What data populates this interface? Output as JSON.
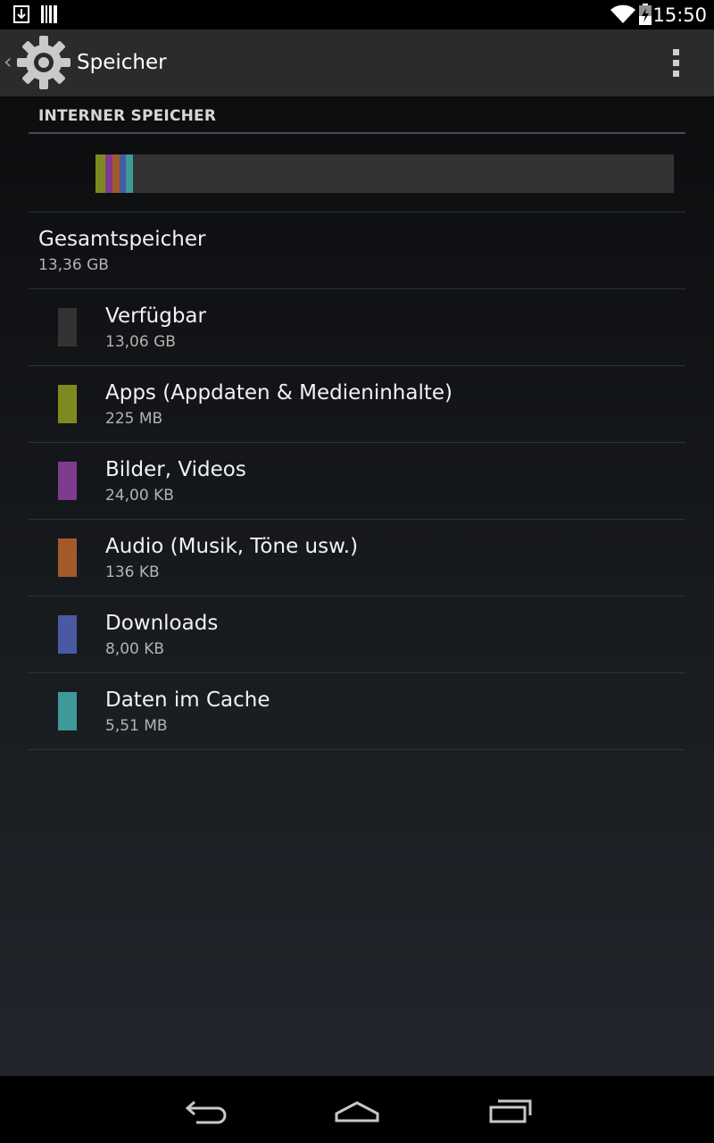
{
  "status_bar": {
    "time": "15:50",
    "icons": [
      "download-icon",
      "barcode-icon",
      "wifi-icon",
      "battery-charging-icon"
    ]
  },
  "action_bar": {
    "title": "Speicher",
    "icon": "settings-gear-icon",
    "overflow_icon": "overflow-menu-icon"
  },
  "storage": {
    "section_header": "INTERNER SPEICHER",
    "total": {
      "label": "Gesamtspeicher",
      "value": "13,36 GB"
    },
    "categories": [
      {
        "label": "Verfügbar",
        "value": "13,06 GB",
        "color": "#333333"
      },
      {
        "label": "Apps (Appdaten & Medieninhalte)",
        "value": "225 MB",
        "color": "#7f8a1e"
      },
      {
        "label": "Bilder, Videos",
        "value": "24,00 KB",
        "color": "#7f3b8e"
      },
      {
        "label": "Audio (Musik, Töne usw.)",
        "value": "136 KB",
        "color": "#a25a2a"
      },
      {
        "label": "Downloads",
        "value": "8,00 KB",
        "color": "#4a5aa0"
      },
      {
        "label": "Daten im Cache",
        "value": "5,51 MB",
        "color": "#3e9a98"
      }
    ],
    "usage_bar_segments": [
      {
        "name": "apps",
        "color": "#7f8a1e",
        "fraction": 0.017
      },
      {
        "name": "images",
        "color": "#7f3b8e",
        "fraction": 0.012
      },
      {
        "name": "audio",
        "color": "#a25a2a",
        "fraction": 0.012
      },
      {
        "name": "downloads",
        "color": "#4a5aa0",
        "fraction": 0.012
      },
      {
        "name": "cache",
        "color": "#3e9a98",
        "fraction": 0.012
      }
    ]
  },
  "nav_bar": {
    "icons": [
      "back-icon",
      "home-icon",
      "recent-apps-icon"
    ]
  }
}
